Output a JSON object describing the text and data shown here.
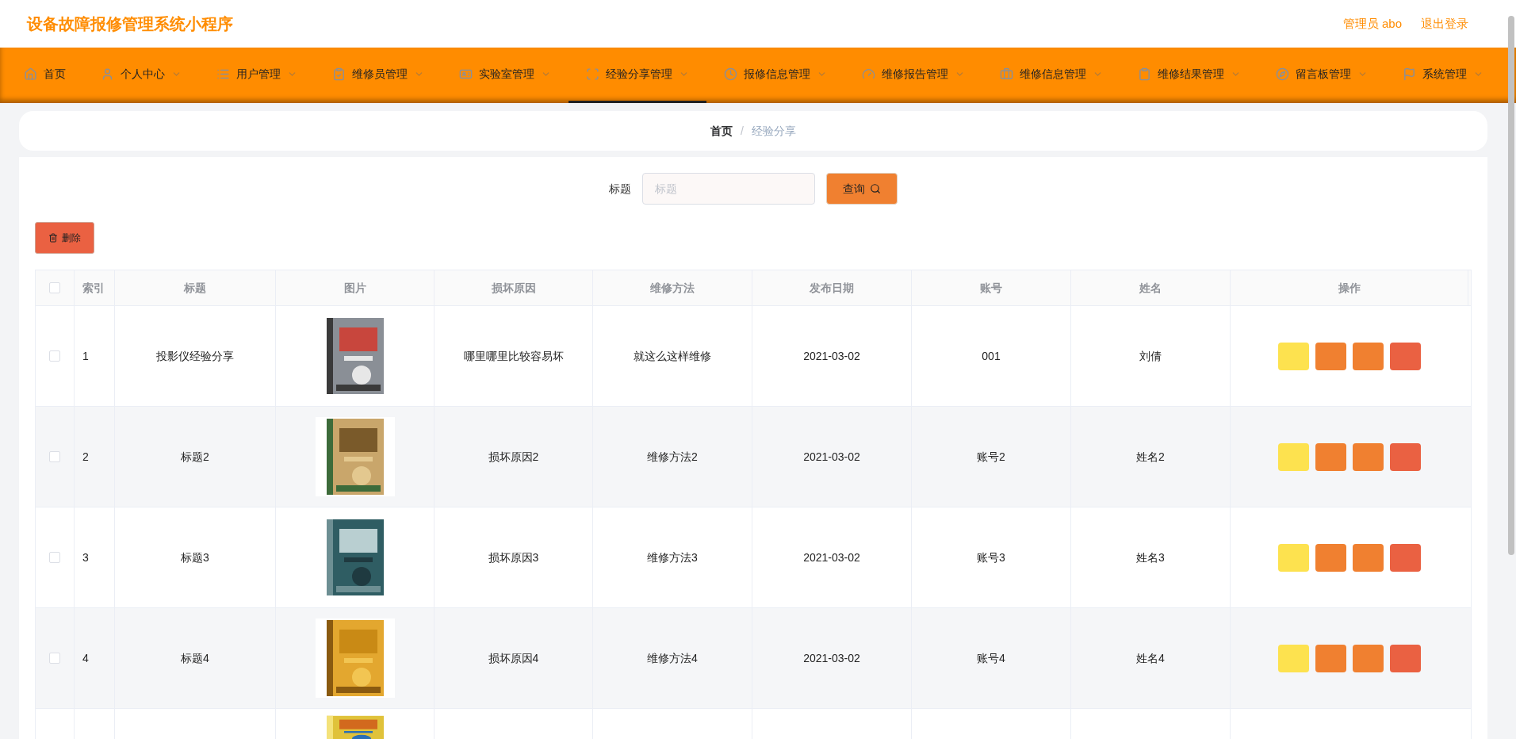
{
  "header": {
    "title": "设备故障报修管理系统小程序",
    "user": "管理员 abo",
    "logout": "退出登录"
  },
  "nav": [
    {
      "label": "首页",
      "selected": false,
      "dropdown": false
    },
    {
      "label": "个人中心",
      "selected": false,
      "dropdown": true
    },
    {
      "label": "用户管理",
      "selected": false,
      "dropdown": true
    },
    {
      "label": "维修员管理",
      "selected": false,
      "dropdown": true
    },
    {
      "label": "实验室管理",
      "selected": false,
      "dropdown": true
    },
    {
      "label": "经验分享管理",
      "selected": true,
      "dropdown": true
    },
    {
      "label": "报修信息管理",
      "selected": false,
      "dropdown": true
    },
    {
      "label": "维修报告管理",
      "selected": false,
      "dropdown": true
    },
    {
      "label": "维修信息管理",
      "selected": false,
      "dropdown": true
    },
    {
      "label": "维修结果管理",
      "selected": false,
      "dropdown": true
    },
    {
      "label": "留言板管理",
      "selected": false,
      "dropdown": true
    },
    {
      "label": "系统管理",
      "selected": false,
      "dropdown": true
    }
  ],
  "breadcrumb": [
    "首页",
    "经验分享"
  ],
  "breadcrumb_separator": "/",
  "search": {
    "label": "标题",
    "placeholder": "标题",
    "button": "查询"
  },
  "delete_button": "删除",
  "table": {
    "all_checked": false,
    "columns": [
      "索引",
      "标题",
      "图片",
      "损坏原因",
      "维修方法",
      "发布日期",
      "账号",
      "姓名",
      "操作"
    ],
    "rows": [
      {
        "checked": false,
        "index": "1",
        "title": "投影仪经验分享",
        "kind": "picture",
        "cause": "哪里哪里比较容易坏",
        "method": "就这么这样维修",
        "date": "2021-03-02",
        "account": "001",
        "name": "刘倩"
      },
      {
        "checked": false,
        "index": "2",
        "title": "标题2",
        "kind": "picture",
        "cause": "损坏原因2",
        "method": "维修方法2",
        "date": "2021-03-02",
        "account": "账号2",
        "name": "姓名2"
      },
      {
        "checked": false,
        "index": "3",
        "title": "标题3",
        "kind": "picture",
        "cause": "损坏原因3",
        "method": "维修方法3",
        "date": "2021-03-02",
        "account": "账号3",
        "name": "姓名3"
      },
      {
        "checked": false,
        "index": "4",
        "title": "标题4",
        "kind": "picture",
        "cause": "损坏原因4",
        "method": "维修方法4",
        "date": "2021-03-02",
        "account": "账号4",
        "name": "姓名4"
      }
    ]
  }
}
